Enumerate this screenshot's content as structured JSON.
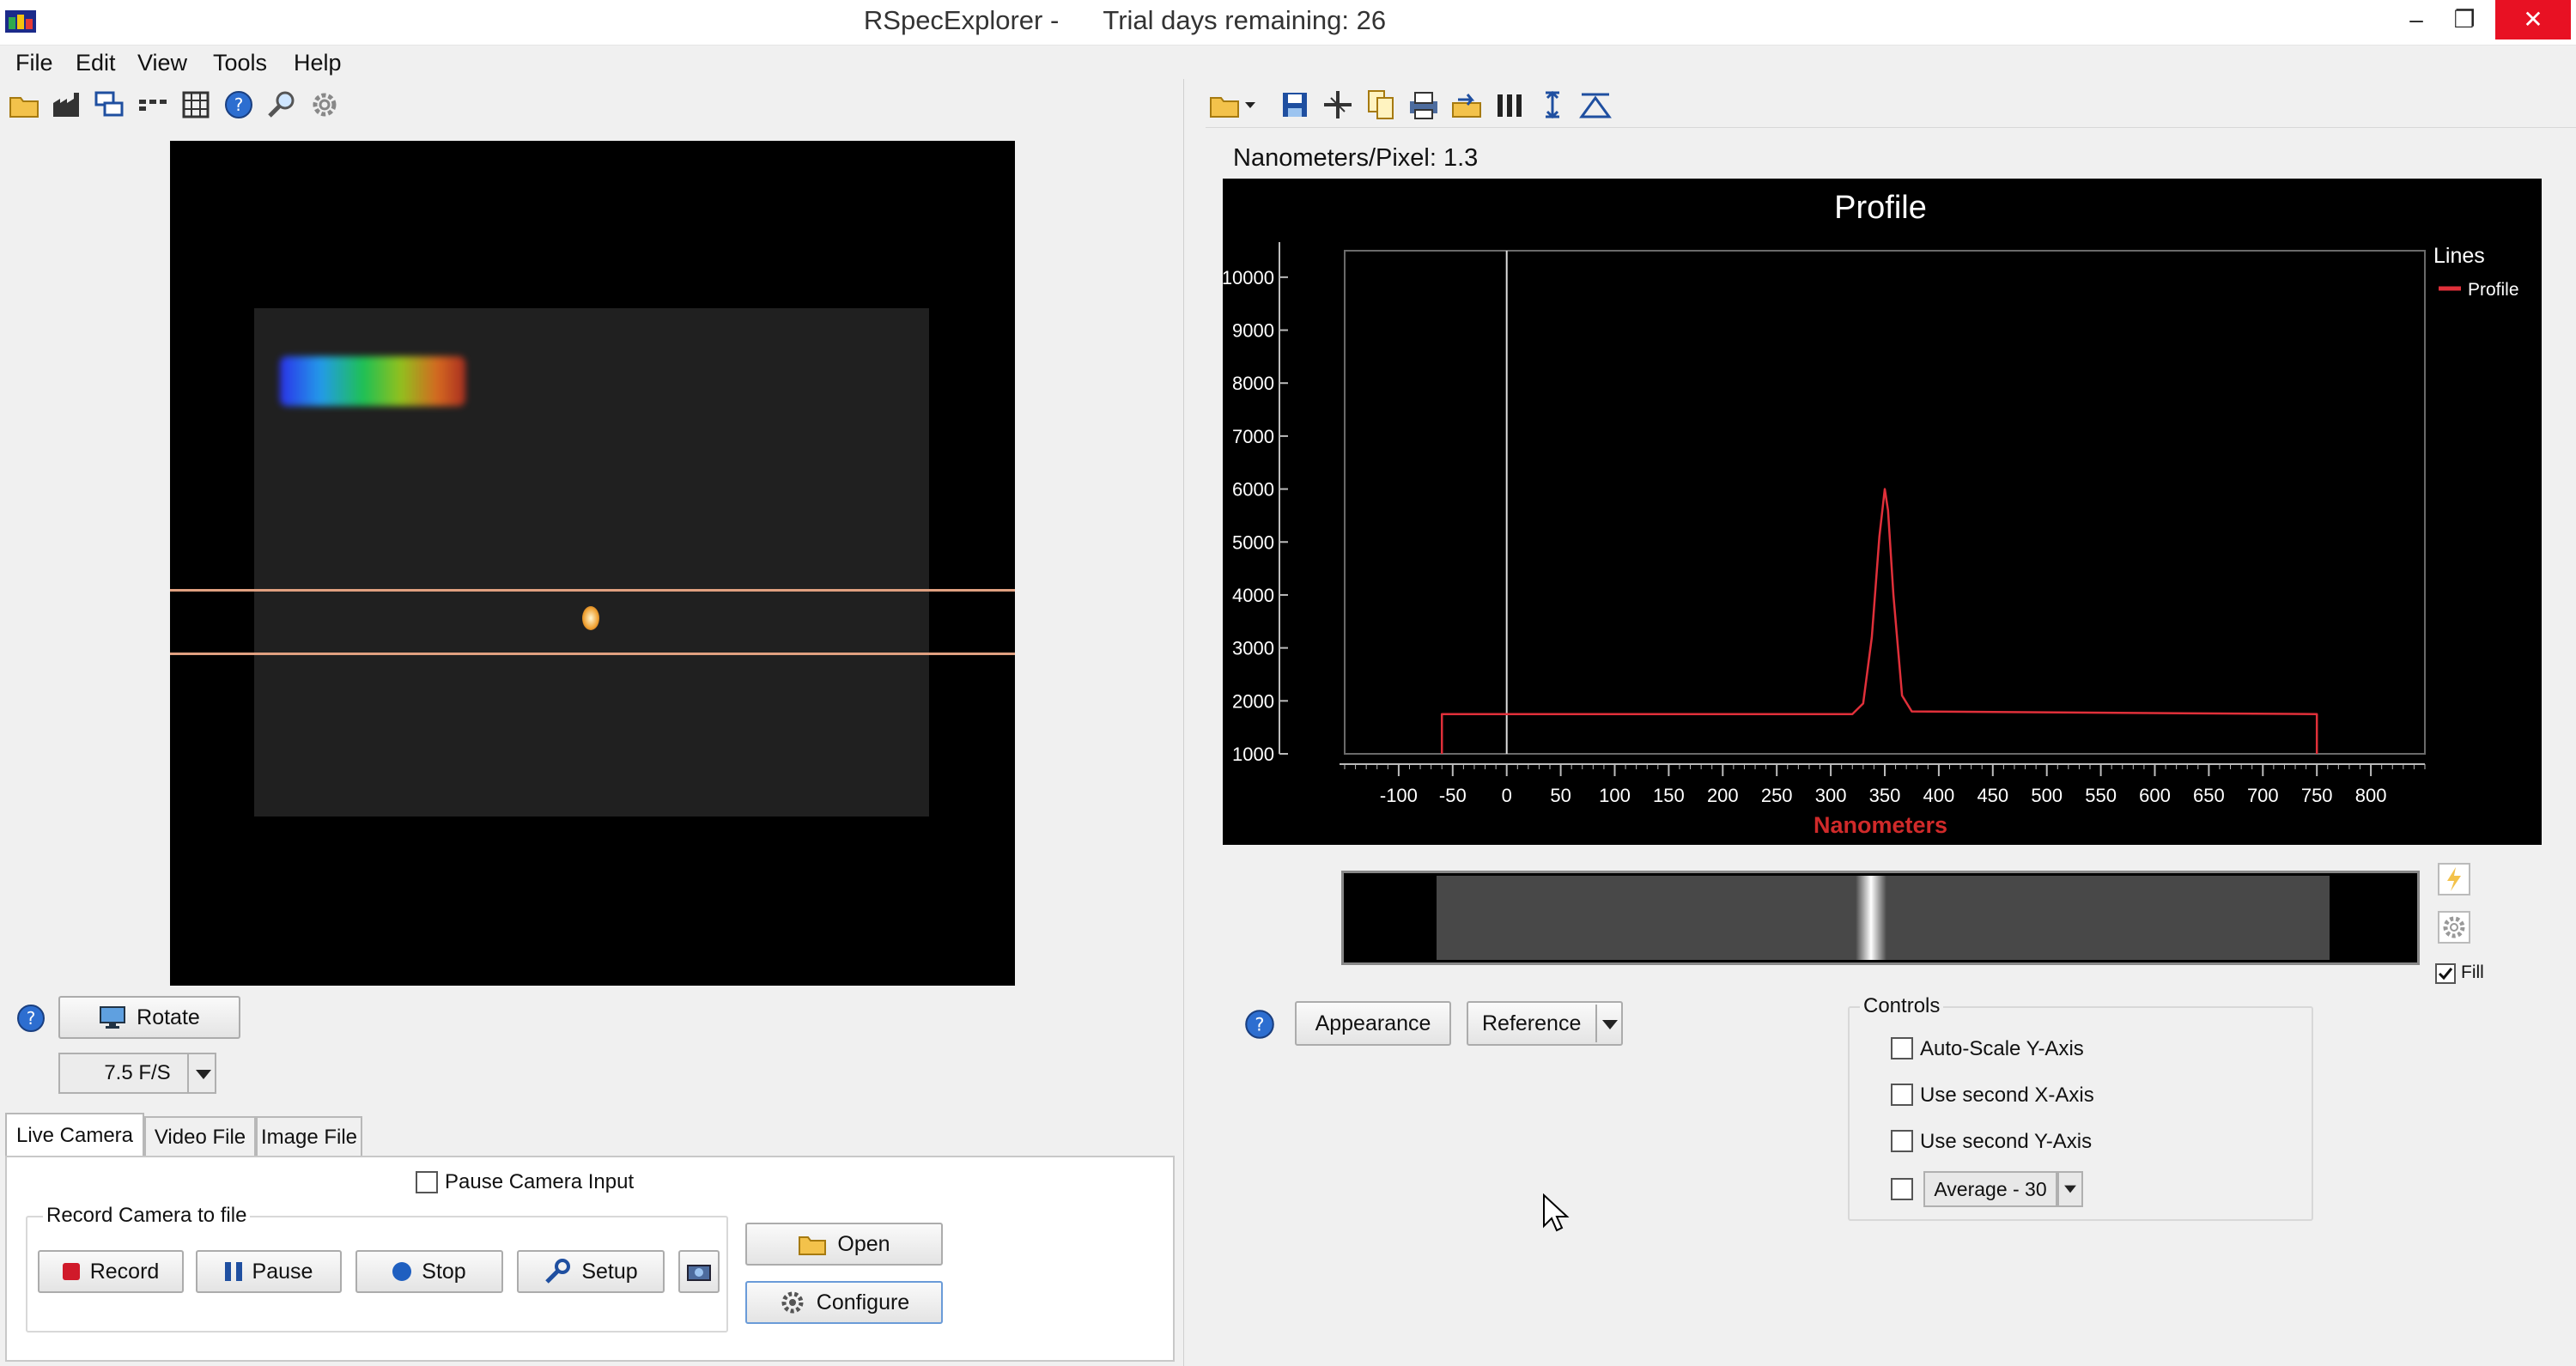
{
  "window": {
    "title": "RSpecExplorer -      Trial days remaining: 26",
    "minimize": "–",
    "maximize": "❐",
    "close": "✕"
  },
  "menu": [
    "File",
    "Edit",
    "View",
    "Tools",
    "Help"
  ],
  "left": {
    "rotate_label": "Rotate",
    "fps_value": "7.5 F/S",
    "tabs": [
      "Live Camera",
      "Video File",
      "Image File"
    ],
    "pause_camera_label": "Pause Camera Input",
    "record_group_title": "Record Camera to file",
    "record_label": "Record",
    "pause_label": "Pause",
    "stop_label": "Stop",
    "setup_label": "Setup",
    "open_label": "Open",
    "configure_label": "Configure"
  },
  "right": {
    "nm_per_pixel": "Nanometers/Pixel: 1.3",
    "appearance_label": "Appearance",
    "reference_label": "Reference",
    "fill_label": "Fill",
    "controls_title": "Controls",
    "auto_scale_label": "Auto-Scale Y-Axis",
    "second_x_label": "Use second X-Axis",
    "second_y_label": "Use second Y-Axis",
    "average_value": "Average - 30"
  },
  "chart_data": {
    "type": "line",
    "title": "Profile",
    "xlabel": "Nanometers",
    "ylabel": "",
    "legend_title": "Lines",
    "legend_position": "top-right",
    "xlim": [
      -150,
      850
    ],
    "ylim": [
      1000,
      10500
    ],
    "x_ticks": [
      -100,
      -50,
      0,
      50,
      100,
      150,
      200,
      250,
      300,
      350,
      400,
      450,
      500,
      550,
      600,
      650,
      700,
      750,
      800
    ],
    "y_ticks": [
      1000,
      2000,
      3000,
      4000,
      5000,
      6000,
      7000,
      8000,
      9000,
      10000
    ],
    "cursor_x": 0,
    "series": [
      {
        "name": "Profile",
        "color": "#e0303a",
        "x": [
          -60,
          -60,
          320,
          330,
          338,
          345,
          350,
          353,
          358,
          366,
          375,
          750,
          750
        ],
        "y": [
          1000,
          1750,
          1750,
          1950,
          3200,
          5100,
          6000,
          5600,
          4000,
          2100,
          1800,
          1750,
          1000
        ]
      }
    ]
  }
}
